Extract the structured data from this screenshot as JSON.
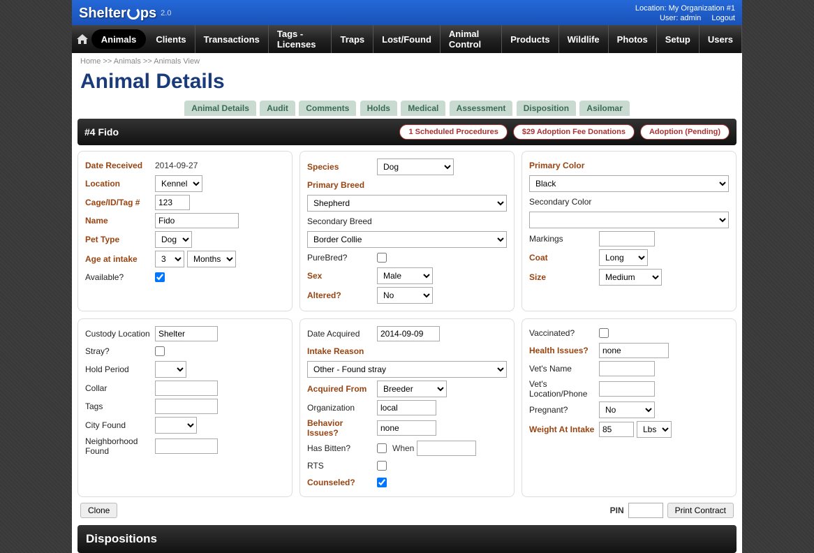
{
  "brand": {
    "name": "Shelter",
    "name2": "ps",
    "version": "2.0"
  },
  "header": {
    "location_label": "Location:",
    "location_value": "My Organization #1",
    "user_label": "User:",
    "user_value": "admin",
    "logout": "Logout"
  },
  "nav": [
    "Animals",
    "Clients",
    "Transactions",
    "Tags - Licenses",
    "Traps",
    "Lost/Found",
    "Animal Control",
    "Products",
    "Wildlife",
    "Photos",
    "Setup",
    "Users"
  ],
  "breadcrumb": {
    "home": "Home",
    "sep": ">>",
    "animals": "Animals",
    "view": "Animals View"
  },
  "page_title": "Animal Details",
  "subnav": [
    "Animal Details",
    "Audit",
    "Comments",
    "Holds",
    "Medical",
    "Assessment",
    "Disposition",
    "Asilomar"
  ],
  "record": {
    "title": "#4 Fido",
    "pills": [
      "1 Scheduled Procedures",
      "$29 Adoption Fee Donations",
      "Adoption (Pending)"
    ]
  },
  "p1col1": {
    "date_received": {
      "label": "Date Received",
      "value": "2014-09-27"
    },
    "location": {
      "label": "Location",
      "value": "Kennel"
    },
    "cage": {
      "label": "Cage/ID/Tag #",
      "value": "123"
    },
    "name": {
      "label": "Name",
      "value": "Fido"
    },
    "pet_type": {
      "label": "Pet Type",
      "value": "Dog"
    },
    "age": {
      "label": "Age at intake",
      "value": "3",
      "unit": "Months"
    },
    "available": {
      "label": "Available?",
      "checked": true
    }
  },
  "p1col2": {
    "species": {
      "label": "Species",
      "value": "Dog"
    },
    "primary_breed": {
      "label": "Primary Breed",
      "value": "Shepherd"
    },
    "secondary_breed": {
      "label": "Secondary Breed",
      "value": "Border Collie"
    },
    "purebred": {
      "label": "PureBred?",
      "checked": false
    },
    "sex": {
      "label": "Sex",
      "value": "Male"
    },
    "altered": {
      "label": "Altered?",
      "value": "No"
    }
  },
  "p1col3": {
    "primary_color": {
      "label": "Primary Color",
      "value": "Black"
    },
    "secondary_color": {
      "label": "Secondary Color",
      "value": ""
    },
    "markings": {
      "label": "Markings",
      "value": ""
    },
    "coat": {
      "label": "Coat",
      "value": "Long"
    },
    "size": {
      "label": "Size",
      "value": "Medium"
    }
  },
  "p2col1": {
    "custody": {
      "label": "Custody Location",
      "value": "Shelter"
    },
    "stray": {
      "label": "Stray?",
      "checked": false
    },
    "hold": {
      "label": "Hold Period",
      "value": ""
    },
    "collar": {
      "label": "Collar",
      "value": ""
    },
    "tags": {
      "label": "Tags",
      "value": ""
    },
    "city": {
      "label": "City Found",
      "value": ""
    },
    "neighborhood": {
      "label": "Neighborhood Found",
      "value": ""
    }
  },
  "p2col2": {
    "date_acquired": {
      "label": "Date Acquired",
      "value": "2014-09-09"
    },
    "intake_reason": {
      "label": "Intake Reason",
      "value": "Other - Found stray"
    },
    "acquired_from": {
      "label": "Acquired From",
      "value": "Breeder"
    },
    "organization": {
      "label": "Organization",
      "value": "local"
    },
    "behavior": {
      "label": "Behavior Issues?",
      "value": "none"
    },
    "bitten": {
      "label": "Has Bitten?",
      "checked": false,
      "when_label": "When",
      "when": ""
    },
    "rts": {
      "label": "RTS",
      "checked": false
    },
    "counseled": {
      "label": "Counseled?",
      "checked": true
    }
  },
  "p2col3": {
    "vaccinated": {
      "label": "Vaccinated?",
      "checked": false
    },
    "health": {
      "label": "Health Issues?",
      "value": "none"
    },
    "vet_name": {
      "label": "Vet's Name",
      "value": ""
    },
    "vet_loc": {
      "label": "Vet's Location/Phone",
      "value": ""
    },
    "pregnant": {
      "label": "Pregnant?",
      "value": "No"
    },
    "weight": {
      "label": "Weight At Intake",
      "value": "85",
      "unit": "Lbs"
    }
  },
  "actions": {
    "clone": "Clone",
    "pin_label": "PIN",
    "print": "Print Contract"
  },
  "dispositions_header": "Dispositions"
}
